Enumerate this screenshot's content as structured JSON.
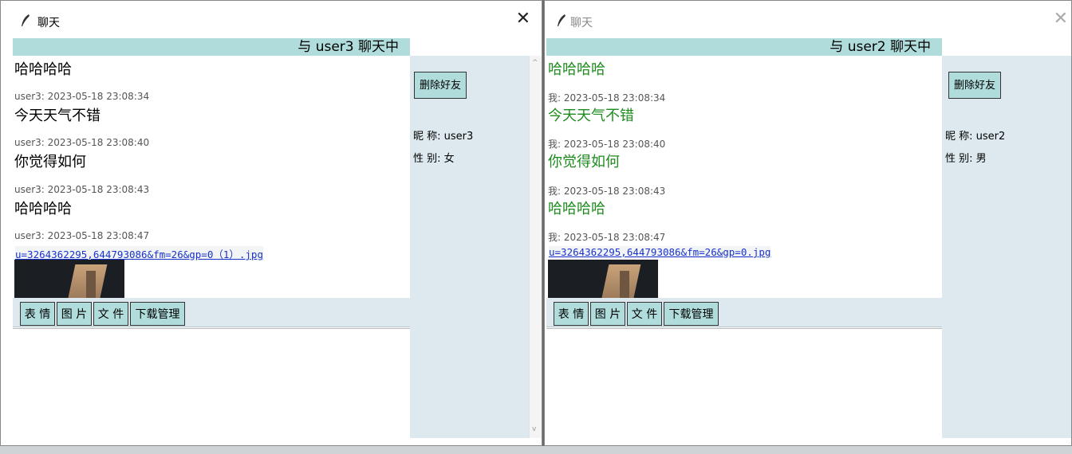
{
  "left_window": {
    "title": "聊天",
    "close_glyph": "✕",
    "header": "与 user3 聊天中",
    "messages": [
      {
        "meta": "",
        "text": "哈哈哈哈"
      },
      {
        "meta": "user3: 2023-05-18 23:08:34",
        "text": "今天天气不错"
      },
      {
        "meta": "user3: 2023-05-18 23:08:40",
        "text": "你觉得如何"
      },
      {
        "meta": "user3: 2023-05-18 23:08:43",
        "text": "哈哈哈哈"
      },
      {
        "meta": "user3: 2023-05-18 23:08:47",
        "text": ""
      }
    ],
    "file_link": "u=3264362295,644793086&fm=26&gp=0（1）.jpg",
    "toolbar": {
      "emoji": "表 情",
      "image": "图 片",
      "file": "文 件",
      "downloads": "下载管理"
    },
    "sidebar": {
      "delete_friend": "删除好友",
      "nickname": "昵 称:  user3",
      "gender": "性 别:  女"
    },
    "scroll_up": "^",
    "scroll_down": "v"
  },
  "right_window": {
    "title": "聊天",
    "close_glyph": "✕",
    "header": "与 user2 聊天中",
    "messages": [
      {
        "meta": "",
        "text": "哈哈哈哈"
      },
      {
        "meta": "我: 2023-05-18 23:08:34",
        "text": "今天天气不错"
      },
      {
        "meta": "我: 2023-05-18 23:08:40",
        "text": "你觉得如何"
      },
      {
        "meta": "我: 2023-05-18 23:08:43",
        "text": "哈哈哈哈"
      },
      {
        "meta": "我: 2023-05-18 23:08:47",
        "text": ""
      }
    ],
    "file_link": "u=3264362295,644793086&fm=26&gp=0.jpg",
    "toolbar": {
      "emoji": "表 情",
      "image": "图 片",
      "file": "文 件",
      "downloads": "下载管理"
    },
    "sidebar": {
      "delete_friend": "删除好友",
      "nickname": "昵 称:  user2",
      "gender": "性 别:  男"
    }
  },
  "colors": {
    "accent": "#b0dcdc",
    "panel": "#dde9ef",
    "self_message": "#1e8b1e",
    "link": "#1a33cc"
  },
  "icons": [
    "feather-icon",
    "close-icon"
  ]
}
